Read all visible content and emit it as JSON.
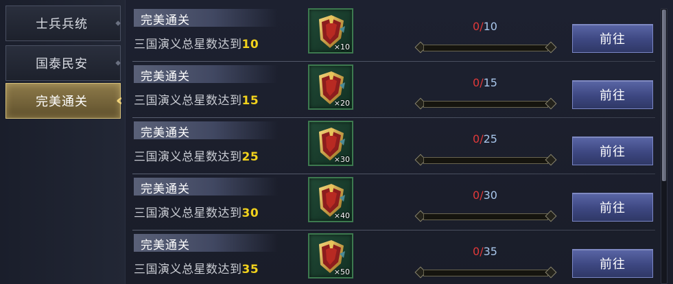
{
  "sidebar": {
    "tabs": [
      {
        "label": "士兵兵统",
        "active": false
      },
      {
        "label": "国泰民安",
        "active": false
      },
      {
        "label": "完美通关",
        "active": true
      }
    ]
  },
  "rows": [
    {
      "title": "完美通关",
      "desc_prefix": "三国演义总星数达到",
      "target": "10",
      "item_count": "×10",
      "progress_current": "0",
      "progress_total": "10",
      "progress_fraction": 0,
      "button": "前往"
    },
    {
      "title": "完美通关",
      "desc_prefix": "三国演义总星数达到",
      "target": "15",
      "item_count": "×20",
      "progress_current": "0",
      "progress_total": "15",
      "progress_fraction": 0,
      "button": "前往"
    },
    {
      "title": "完美通关",
      "desc_prefix": "三国演义总星数达到",
      "target": "25",
      "item_count": "×30",
      "progress_current": "0",
      "progress_total": "25",
      "progress_fraction": 0,
      "button": "前往"
    },
    {
      "title": "完美通关",
      "desc_prefix": "三国演义总星数达到",
      "target": "30",
      "item_count": "×40",
      "progress_current": "0",
      "progress_total": "30",
      "progress_fraction": 0,
      "button": "前往"
    },
    {
      "title": "完美通关",
      "desc_prefix": "三国演义总星数达到",
      "target": "35",
      "item_count": "×50",
      "progress_current": "0",
      "progress_total": "35",
      "progress_fraction": 0,
      "button": "前往"
    }
  ],
  "progress_separator": "/",
  "icons": {
    "reward_item": "shield-reward-icon",
    "tab_selected": "double-chevron-left-icon"
  },
  "colors": {
    "target_number": "#f2d21c",
    "progress_current": "#e0393a",
    "progress_total": "#a9c7ec",
    "go_button": "#3d4781",
    "active_tab": "#8d7a4a"
  }
}
